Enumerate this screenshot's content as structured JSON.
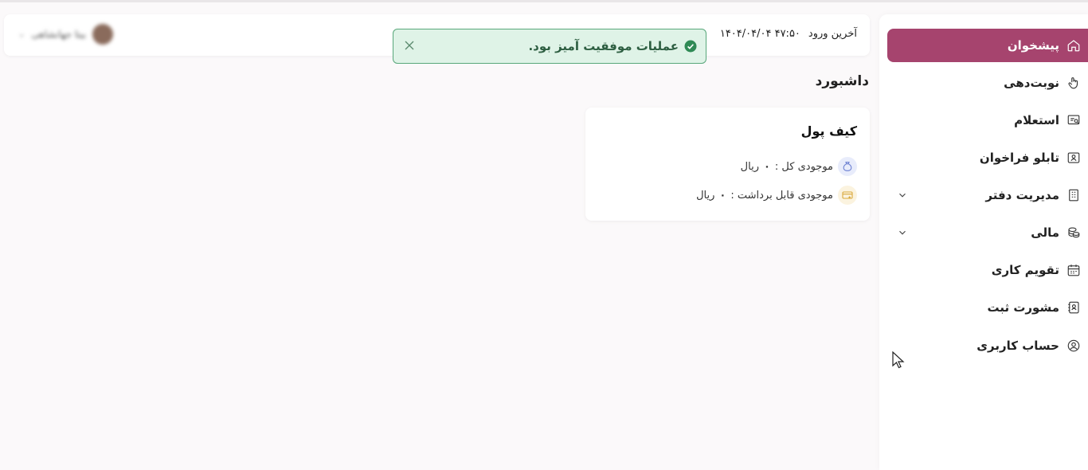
{
  "header": {
    "last_login_label": "آخرین ورود",
    "last_login_value": "۱۴۰۴/۰۴/۰۴ ۴۷:۵۰",
    "user_name": "بیتا جهانشاهی",
    "user_caret": "⌄"
  },
  "toast": {
    "message": "عملیات موفقیت آمیز بود.",
    "close_icon": "close-icon",
    "check_icon": "check-circle-icon"
  },
  "page": {
    "title": "داشبورد"
  },
  "wallet": {
    "title": "کیف پول",
    "total_label": "موجودی کل :",
    "total_value": "۰",
    "total_unit": "ریال",
    "withdrawable_label": "موجودی قابل برداشت :",
    "withdrawable_value": "۰",
    "withdrawable_unit": "ریال"
  },
  "sidebar": {
    "items": [
      {
        "label": "پیشخوان",
        "icon": "home-icon",
        "active": true
      },
      {
        "label": "نوبت‌دهی",
        "icon": "hand-pointer-icon"
      },
      {
        "label": "استعلام",
        "icon": "inquiry-icon"
      },
      {
        "label": "تابلو فراخوان",
        "icon": "call-board-icon"
      },
      {
        "label": "مدیریت دفتر",
        "icon": "building-icon",
        "expandable": true
      },
      {
        "label": "مالی",
        "icon": "coins-icon",
        "expandable": true
      },
      {
        "label": "تقویم کاری",
        "icon": "calendar-icon"
      },
      {
        "label": "مشورت ثبت",
        "icon": "contact-book-icon"
      },
      {
        "label": "حساب کاربری",
        "icon": "user-circle-icon"
      }
    ]
  },
  "colors": {
    "accent": "#a6446e",
    "toast_bg": "#dff3e7",
    "toast_border": "#58a77a",
    "toast_text": "#2d5e41"
  }
}
